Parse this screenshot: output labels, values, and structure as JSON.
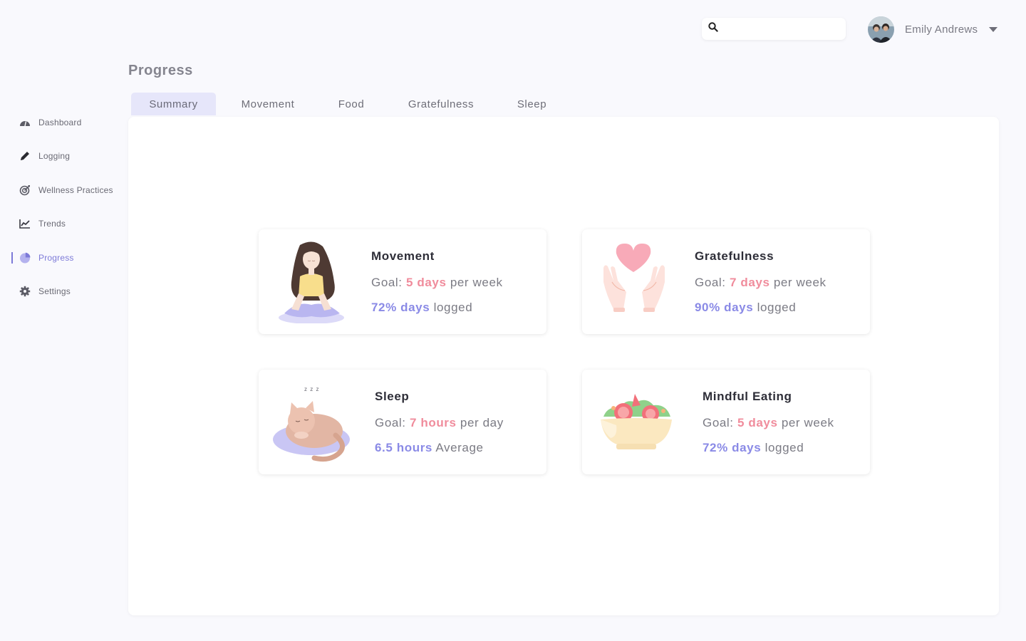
{
  "header": {
    "search_placeholder": "",
    "user_name": "Emily Andrews"
  },
  "sidebar": {
    "items": [
      {
        "label": "Dashboard",
        "icon": "gauge-icon"
      },
      {
        "label": "Logging",
        "icon": "pencil-icon"
      },
      {
        "label": "Wellness Practices",
        "icon": "target-icon"
      },
      {
        "label": "Trends",
        "icon": "trend-chart-icon"
      },
      {
        "label": "Progress",
        "icon": "pie-chart-icon",
        "active": true
      },
      {
        "label": "Settings",
        "icon": "gear-icon"
      }
    ]
  },
  "page": {
    "title": "Progress"
  },
  "tabs": [
    "Summary",
    "Movement",
    "Food",
    "Gratefulness",
    "Sleep"
  ],
  "active_tab": "Summary",
  "cards": {
    "movement": {
      "title": "Movement",
      "goal_prefix": "Goal:",
      "goal_value": "5 days",
      "goal_suffix": "per week",
      "stat_value": "72% days",
      "stat_suffix": "logged"
    },
    "gratefulness": {
      "title": "Gratefulness",
      "goal_prefix": "Goal:",
      "goal_value": "7 days",
      "goal_suffix": "per week",
      "stat_value": "90% days",
      "stat_suffix": "logged"
    },
    "sleep": {
      "title": "Sleep",
      "goal_prefix": "Goal:",
      "goal_value": "7 hours",
      "goal_suffix": "per day",
      "stat_value": "6.5 hours",
      "stat_suffix": "Average",
      "zzz": "z z z"
    },
    "mindful_eating": {
      "title": "Mindful Eating",
      "goal_prefix": "Goal:",
      "goal_value": "5 days",
      "goal_suffix": "per week",
      "stat_value": "72% days",
      "stat_suffix": "logged"
    }
  },
  "colors": {
    "accent": "#7d7ad8",
    "goal_highlight": "#f08c9c",
    "stat_highlight": "#8a8ae6",
    "tab_active_bg": "#e6e6fa",
    "background": "#f9f9fd"
  }
}
